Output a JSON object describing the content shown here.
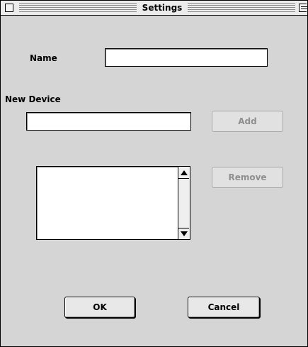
{
  "window": {
    "title": "Settings"
  },
  "name_field": {
    "label": "Name",
    "value": ""
  },
  "new_device": {
    "label": "New Device",
    "value": "",
    "add_label": "Add"
  },
  "devices": {
    "items": [],
    "remove_label": "Remove"
  },
  "actions": {
    "ok_label": "OK",
    "cancel_label": "Cancel"
  },
  "icons": {
    "close": "close-box-icon",
    "zoom": "zoom-box-icon",
    "scroll_up": "scroll-up-arrow-icon",
    "scroll_down": "scroll-down-arrow-icon"
  }
}
